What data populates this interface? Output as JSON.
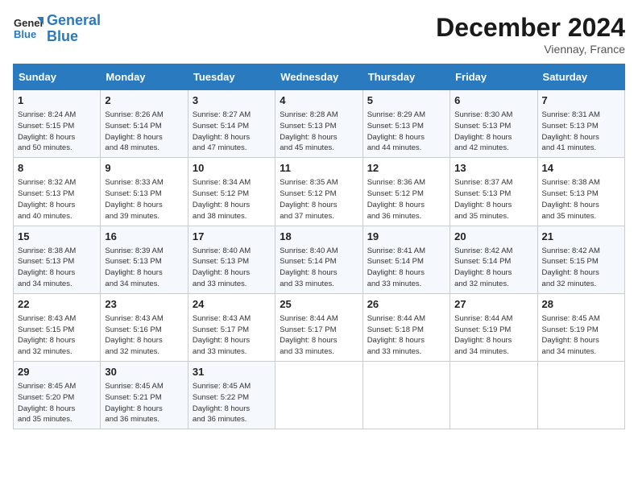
{
  "header": {
    "logo_line1": "General",
    "logo_line2": "Blue",
    "month": "December 2024",
    "location": "Viennay, France"
  },
  "columns": [
    "Sunday",
    "Monday",
    "Tuesday",
    "Wednesday",
    "Thursday",
    "Friday",
    "Saturday"
  ],
  "weeks": [
    [
      {
        "day": "1",
        "info": "Sunrise: 8:24 AM\nSunset: 5:15 PM\nDaylight: 8 hours\nand 50 minutes."
      },
      {
        "day": "2",
        "info": "Sunrise: 8:26 AM\nSunset: 5:14 PM\nDaylight: 8 hours\nand 48 minutes."
      },
      {
        "day": "3",
        "info": "Sunrise: 8:27 AM\nSunset: 5:14 PM\nDaylight: 8 hours\nand 47 minutes."
      },
      {
        "day": "4",
        "info": "Sunrise: 8:28 AM\nSunset: 5:13 PM\nDaylight: 8 hours\nand 45 minutes."
      },
      {
        "day": "5",
        "info": "Sunrise: 8:29 AM\nSunset: 5:13 PM\nDaylight: 8 hours\nand 44 minutes."
      },
      {
        "day": "6",
        "info": "Sunrise: 8:30 AM\nSunset: 5:13 PM\nDaylight: 8 hours\nand 42 minutes."
      },
      {
        "day": "7",
        "info": "Sunrise: 8:31 AM\nSunset: 5:13 PM\nDaylight: 8 hours\nand 41 minutes."
      }
    ],
    [
      {
        "day": "8",
        "info": "Sunrise: 8:32 AM\nSunset: 5:13 PM\nDaylight: 8 hours\nand 40 minutes."
      },
      {
        "day": "9",
        "info": "Sunrise: 8:33 AM\nSunset: 5:13 PM\nDaylight: 8 hours\nand 39 minutes."
      },
      {
        "day": "10",
        "info": "Sunrise: 8:34 AM\nSunset: 5:12 PM\nDaylight: 8 hours\nand 38 minutes."
      },
      {
        "day": "11",
        "info": "Sunrise: 8:35 AM\nSunset: 5:12 PM\nDaylight: 8 hours\nand 37 minutes."
      },
      {
        "day": "12",
        "info": "Sunrise: 8:36 AM\nSunset: 5:12 PM\nDaylight: 8 hours\nand 36 minutes."
      },
      {
        "day": "13",
        "info": "Sunrise: 8:37 AM\nSunset: 5:13 PM\nDaylight: 8 hours\nand 35 minutes."
      },
      {
        "day": "14",
        "info": "Sunrise: 8:38 AM\nSunset: 5:13 PM\nDaylight: 8 hours\nand 35 minutes."
      }
    ],
    [
      {
        "day": "15",
        "info": "Sunrise: 8:38 AM\nSunset: 5:13 PM\nDaylight: 8 hours\nand 34 minutes."
      },
      {
        "day": "16",
        "info": "Sunrise: 8:39 AM\nSunset: 5:13 PM\nDaylight: 8 hours\nand 34 minutes."
      },
      {
        "day": "17",
        "info": "Sunrise: 8:40 AM\nSunset: 5:13 PM\nDaylight: 8 hours\nand 33 minutes."
      },
      {
        "day": "18",
        "info": "Sunrise: 8:40 AM\nSunset: 5:14 PM\nDaylight: 8 hours\nand 33 minutes."
      },
      {
        "day": "19",
        "info": "Sunrise: 8:41 AM\nSunset: 5:14 PM\nDaylight: 8 hours\nand 33 minutes."
      },
      {
        "day": "20",
        "info": "Sunrise: 8:42 AM\nSunset: 5:14 PM\nDaylight: 8 hours\nand 32 minutes."
      },
      {
        "day": "21",
        "info": "Sunrise: 8:42 AM\nSunset: 5:15 PM\nDaylight: 8 hours\nand 32 minutes."
      }
    ],
    [
      {
        "day": "22",
        "info": "Sunrise: 8:43 AM\nSunset: 5:15 PM\nDaylight: 8 hours\nand 32 minutes."
      },
      {
        "day": "23",
        "info": "Sunrise: 8:43 AM\nSunset: 5:16 PM\nDaylight: 8 hours\nand 32 minutes."
      },
      {
        "day": "24",
        "info": "Sunrise: 8:43 AM\nSunset: 5:17 PM\nDaylight: 8 hours\nand 33 minutes."
      },
      {
        "day": "25",
        "info": "Sunrise: 8:44 AM\nSunset: 5:17 PM\nDaylight: 8 hours\nand 33 minutes."
      },
      {
        "day": "26",
        "info": "Sunrise: 8:44 AM\nSunset: 5:18 PM\nDaylight: 8 hours\nand 33 minutes."
      },
      {
        "day": "27",
        "info": "Sunrise: 8:44 AM\nSunset: 5:19 PM\nDaylight: 8 hours\nand 34 minutes."
      },
      {
        "day": "28",
        "info": "Sunrise: 8:45 AM\nSunset: 5:19 PM\nDaylight: 8 hours\nand 34 minutes."
      }
    ],
    [
      {
        "day": "29",
        "info": "Sunrise: 8:45 AM\nSunset: 5:20 PM\nDaylight: 8 hours\nand 35 minutes."
      },
      {
        "day": "30",
        "info": "Sunrise: 8:45 AM\nSunset: 5:21 PM\nDaylight: 8 hours\nand 36 minutes."
      },
      {
        "day": "31",
        "info": "Sunrise: 8:45 AM\nSunset: 5:22 PM\nDaylight: 8 hours\nand 36 minutes."
      },
      null,
      null,
      null,
      null
    ]
  ]
}
